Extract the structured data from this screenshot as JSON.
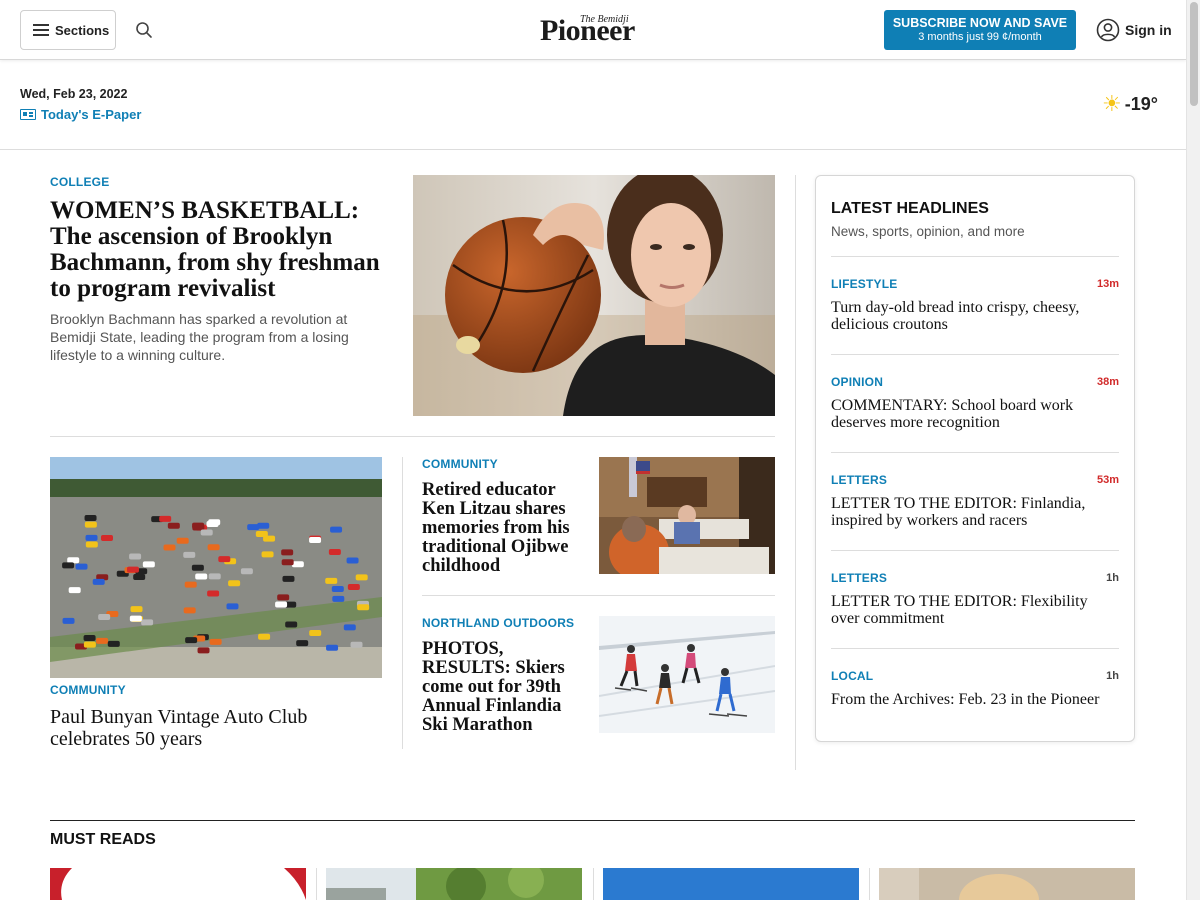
{
  "header": {
    "sections_label": "Sections",
    "logo_small": "The Bemidji",
    "logo_big": "Pioneer",
    "subscribe_line1": "SUBSCRIBE NOW AND SAVE",
    "subscribe_line2": "3 months just 99 ¢/month",
    "signin_label": "Sign in",
    "accent_color": "#0f7fb5"
  },
  "datebar": {
    "date": "Wed, Feb 23, 2022",
    "epaper_label": "Today's E-Paper",
    "temperature": "-19°",
    "weather_icon": "sun-icon"
  },
  "lead": {
    "category": "COLLEGE",
    "title": "WOMEN’S BASKETBALL: The ascension of Brooklyn Bachmann, from shy freshman to program revivalist",
    "description": "Brooklyn Bachmann has sparked a revolution at Bemidji State, leading the program from a losing lifestyle to a winning culture."
  },
  "stories": [
    {
      "category": "COMMUNITY",
      "title": "Paul Bunyan Vintage Auto Club celebrates 50 years"
    },
    {
      "category": "COMMUNITY",
      "title": "Retired educator Ken Litzau shares memories from his traditional Ojibwe childhood"
    },
    {
      "category": "NORTHLAND OUTDOORS",
      "title": "PHOTOS, RESULTS: Skiers come out for 39th Annual Finlandia Ski Marathon"
    }
  ],
  "latest": {
    "title": "LATEST HEADLINES",
    "subtitle": "News, sports, opinion, and more",
    "items": [
      {
        "category": "LIFESTYLE",
        "time": "13m",
        "title": "Turn day-old bread into crispy, cheesy, delicious croutons"
      },
      {
        "category": "OPINION",
        "time": "38m",
        "title": "COMMENTARY: School board work deserves more recognition"
      },
      {
        "category": "LETTERS",
        "time": "53m",
        "title": "LETTER TO THE EDITOR: Finlandia, inspired by workers and racers"
      },
      {
        "category": "LETTERS",
        "time": "1h",
        "title": "LETTER TO THE EDITOR: Flexibility over commitment"
      },
      {
        "category": "LOCAL",
        "time": "1h",
        "title": "From the Archives: Feb. 23 in the Pioneer"
      }
    ]
  },
  "must_reads": {
    "title": "MUST READS"
  }
}
